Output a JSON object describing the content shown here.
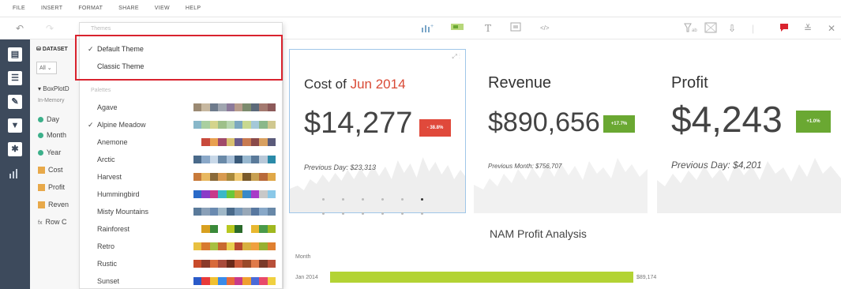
{
  "menu": [
    "FILE",
    "INSERT",
    "FORMAT",
    "SHARE",
    "VIEW",
    "HELP"
  ],
  "datasets": {
    "title": "DATASET",
    "filter_value": "All",
    "items": [
      {
        "label": "BoxPlotD",
        "kind": "root"
      },
      {
        "label": "In-Memory",
        "kind": "sub"
      },
      {
        "label": "Day",
        "kind": "dim"
      },
      {
        "label": "Month",
        "kind": "dim"
      },
      {
        "label": "Year",
        "kind": "dim"
      },
      {
        "label": "Cost",
        "kind": "measure"
      },
      {
        "label": "Profit",
        "kind": "measure"
      },
      {
        "label": "Reven",
        "kind": "measure"
      },
      {
        "label": "Row C",
        "kind": "calc"
      }
    ]
  },
  "theme_panel": {
    "themes_heading": "Themes",
    "themes": [
      {
        "label": "Default Theme",
        "checked": true
      },
      {
        "label": "Classic Theme",
        "checked": false
      }
    ],
    "palettes_heading": "Palettes",
    "palettes": [
      {
        "label": "Agave",
        "checked": false,
        "colors": [
          "#9b8a73",
          "#c7b8a0",
          "#6e7b8c",
          "#a0a6b0",
          "#8c7a9b",
          "#b89c8c",
          "#7c8b6e",
          "#5c6a7a",
          "#a47a70",
          "#8c5a5a"
        ]
      },
      {
        "label": "Alpine Meadow",
        "checked": true,
        "colors": [
          "#88b7c9",
          "#a9cfa0",
          "#d4d48c",
          "#9ec08a",
          "#b8d6b0",
          "#7ca8c0",
          "#c8d890",
          "#a4c8d8",
          "#8ab88a",
          "#d0c890"
        ]
      },
      {
        "label": "Anemone",
        "checked": false,
        "colors": [
          "#ffffff",
          "#c84a3c",
          "#e8a050",
          "#a04a6a",
          "#d8c070",
          "#6a5a8a",
          "#c87a50",
          "#8a4a4a",
          "#d8a060",
          "#5a5a7a"
        ]
      },
      {
        "label": "Arctic",
        "checked": false,
        "colors": [
          "#4a6a8a",
          "#8aa8c8",
          "#c8d8e8",
          "#6a8aa8",
          "#a8c0d8",
          "#3a5a7a",
          "#98b8d0",
          "#5a7a9a",
          "#b8c8d8",
          "#2a8aa8"
        ]
      },
      {
        "label": "Harvest",
        "checked": false,
        "colors": [
          "#c87a3a",
          "#e8b860",
          "#8a6a3a",
          "#d89a50",
          "#a8883a",
          "#f0c870",
          "#7a5a2a",
          "#c8a050",
          "#b86a3a",
          "#e0a848"
        ]
      },
      {
        "label": "Hummingbird",
        "checked": false,
        "colors": [
          "#2a6ac8",
          "#8a3ac8",
          "#c83a8a",
          "#3ab8c8",
          "#6ac83a",
          "#c8a83a",
          "#3a8ac8",
          "#a83ac8",
          "#c8c8c8",
          "#8ac8e8"
        ]
      },
      {
        "label": "Misty Mountains",
        "checked": false,
        "colors": [
          "#5a7a9a",
          "#8aa0b8",
          "#6a8ab0",
          "#a0b8c8",
          "#4a6a8a",
          "#7898b8",
          "#98a8b8",
          "#5878a0",
          "#88a8c8",
          "#6888a8"
        ]
      },
      {
        "label": "Rainforest",
        "checked": false,
        "colors": [
          "#ffffff",
          "#d8a020",
          "#3a8a3a",
          "#ffffff",
          "#b8c820",
          "#2a6a2a",
          "#ffffff",
          "#e8b830",
          "#4a9a4a",
          "#a0b820"
        ]
      },
      {
        "label": "Retro",
        "checked": false,
        "colors": [
          "#e8c040",
          "#d87a30",
          "#a8c040",
          "#c86a30",
          "#e8d050",
          "#b84a30",
          "#d8b040",
          "#f0a040",
          "#98b030",
          "#e08030"
        ]
      },
      {
        "label": "Rustic",
        "checked": false,
        "colors": [
          "#c84a2a",
          "#8a3a2a",
          "#d86a3a",
          "#a84a3a",
          "#6a2a1a",
          "#c85a3a",
          "#9a4a2a",
          "#e07a4a",
          "#7a3a2a",
          "#b8503a"
        ]
      },
      {
        "label": "Sunset",
        "checked": false,
        "colors": [
          "#2a5ac8",
          "#e83a3a",
          "#f0c030",
          "#3a8ae8",
          "#e86a3a",
          "#c83a8a",
          "#f0a030",
          "#4a6ad8",
          "#e84a6a",
          "#f0d040"
        ]
      }
    ]
  },
  "kpis": [
    {
      "title_prefix": "Cost of ",
      "title_highlight": "Jun 2014",
      "value": "$14,277",
      "badge": "- 38.8%",
      "badge_color": "#e0493b",
      "sub": "Previous Day: $23,313"
    },
    {
      "title_prefix": "Revenue",
      "title_highlight": "",
      "value": "$890,656",
      "badge": "+17.7%",
      "badge_color": "#6aa832",
      "sub": "Previous Month: $756,707"
    },
    {
      "title_prefix": "Profit",
      "title_highlight": "",
      "value": "$4,243",
      "badge": "+1.0%",
      "badge_color": "#6aa832",
      "sub": "Previous Day: $4,201"
    }
  ],
  "carousel": {
    "count": 12,
    "active_index": 5
  },
  "chart_section": {
    "title": "NAM Profit Analysis",
    "axis_label": "Month",
    "chart_data": {
      "type": "bar",
      "categories": [
        "Jan 2014"
      ],
      "values": [
        89174
      ],
      "value_labels": [
        "$89,174"
      ],
      "title": "NAM Profit Analysis",
      "ylabel": "Month",
      "xlim": [
        0,
        89174
      ]
    }
  }
}
